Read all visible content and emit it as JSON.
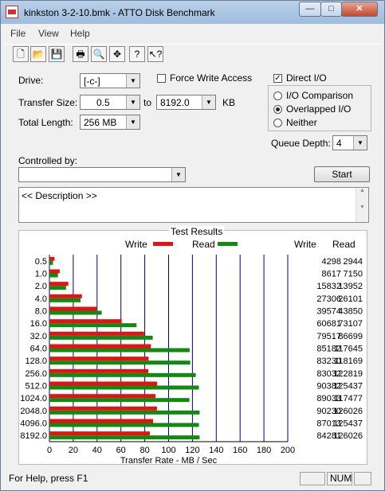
{
  "window": {
    "title": "kinkston 3-2-10.bmk - ATTO Disk Benchmark",
    "minimize_glyph": "—",
    "maximize_glyph": "□",
    "close_glyph": "✕"
  },
  "menu": [
    "File",
    "View",
    "Help"
  ],
  "toolbar_icons": [
    "new-icon",
    "open-icon",
    "save-icon",
    "print-icon",
    "print-preview-icon",
    "move-icon",
    "help-icon",
    "context-help-icon"
  ],
  "toolbar_glyphs": [
    "🗋",
    "📂",
    "💾",
    "🖶",
    "🔍",
    "✥",
    "?",
    "↖?"
  ],
  "settings": {
    "drive_label": "Drive:",
    "drive_value": "[-c-]",
    "force_write_label": "Force Write Access",
    "force_write_checked": false,
    "direct_io_label": "Direct I/O",
    "direct_io_checked": true,
    "check_mark": "✓",
    "transfer_size_label": "Transfer Size:",
    "transfer_from": "0.5",
    "to_label": "to",
    "transfer_to": "8192.0",
    "kb_label": "KB",
    "total_length_label": "Total Length:",
    "total_length_value": "256 MB",
    "io_options": [
      {
        "label": "I/O Comparison",
        "selected": false
      },
      {
        "label": "Overlapped I/O",
        "selected": true
      },
      {
        "label": "Neither",
        "selected": false
      }
    ],
    "queue_depth_label": "Queue Depth:",
    "queue_depth_value": "4",
    "controlled_by_label": "Controlled by:",
    "controlled_by_value": "",
    "start_label": "Start",
    "description": "<< Description >>",
    "dropdown_arrow": "▼"
  },
  "results": {
    "title": "Test Results",
    "write_legend": "Write",
    "read_legend": "Read",
    "write_header": "Write",
    "read_header": "Read",
    "write_color": "#e81010",
    "read_color": "#108a10",
    "grid_color": "#000080"
  },
  "chart_data": {
    "type": "bar",
    "orientation": "horizontal",
    "title": "Test Results",
    "xlabel": "Transfer Rate - MB / Sec",
    "xlim": [
      0,
      200
    ],
    "xticks": [
      0,
      20,
      40,
      60,
      80,
      100,
      120,
      140,
      160,
      180,
      200
    ],
    "categories": [
      "0.5",
      "1.0",
      "2.0",
      "4.0",
      "8.0",
      "16.0",
      "32.0",
      "64.0",
      "128.0",
      "256.0",
      "512.0",
      "1024.0",
      "2048.0",
      "4096.0",
      "8192.0"
    ],
    "series": [
      {
        "name": "Write",
        "color": "#e81010",
        "values": [
          4298,
          8617,
          15832,
          27306,
          39574,
          60681,
          79517,
          85182,
          83230,
          83032,
          90382,
          89033,
          90230,
          87013,
          84281
        ]
      },
      {
        "name": "Read",
        "color": "#108a10",
        "values": [
          2944,
          7150,
          13952,
          26101,
          43850,
          73107,
          86699,
          117645,
          118169,
          122819,
          125437,
          117477,
          126026,
          125437,
          126026
        ]
      }
    ],
    "value_unit_note": "bar length uses value/1000 MB/s"
  },
  "status": {
    "help": "For Help, press F1",
    "num": "NUM"
  }
}
